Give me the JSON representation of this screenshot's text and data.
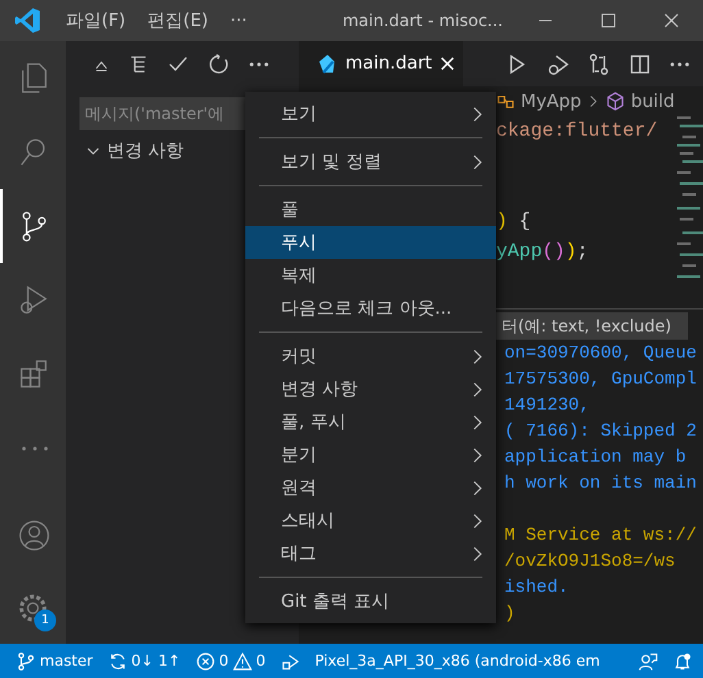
{
  "title_bar": {
    "menus": [
      "파일(F)",
      "편집(E)",
      "···"
    ],
    "title": "main.dart - misoc..."
  },
  "activity_bar": {
    "items": [
      {
        "kind": "files",
        "selected": false
      },
      {
        "kind": "search",
        "selected": false
      },
      {
        "kind": "scm",
        "selected": true
      },
      {
        "kind": "debug",
        "selected": false
      },
      {
        "kind": "extensions",
        "selected": false
      },
      {
        "kind": "more",
        "selected": false
      }
    ],
    "settings_badge": "1"
  },
  "sidebar": {
    "message": {
      "placeholder": "메시지('master'에"
    },
    "section": {
      "label": "변경 사항",
      "expanded": true
    }
  },
  "tab": {
    "label": "main.dart",
    "selected": true
  },
  "breadcrumb": [
    "MyApp",
    "build"
  ],
  "code_lines": [
    {
      "kind": "code",
      "tokens": [
        {
          "text": "ckage:flutter/",
          "kind": "string"
        }
      ]
    },
    {
      "kind": "blank"
    },
    {
      "kind": "blank"
    },
    {
      "kind": "code",
      "tokens": [
        {
          "text": ")",
          "kind": "bracket"
        },
        {
          "text": " {",
          "kind": "plain"
        }
      ]
    },
    {
      "kind": "code",
      "tokens": [
        {
          "text": "yApp",
          "kind": "class"
        },
        {
          "text": "()",
          "kind": "bracket2"
        },
        {
          "text": ")",
          "kind": "bracket"
        },
        {
          "text": ";",
          "kind": "plain"
        }
      ]
    }
  ],
  "panel": {
    "filter": {
      "placeholder": "터(예: text, !exclude)"
    },
    "lines": [
      {
        "text": "on=30970600, Queue",
        "kind": "info"
      },
      {
        "text": "17575300, GpuCompl",
        "kind": "info"
      },
      {
        "text": "1491230,",
        "kind": "info"
      },
      {
        "text": "( 7166): Skipped 2",
        "kind": "info"
      },
      {
        "text": "application may b",
        "kind": "info"
      },
      {
        "text": "h work on its main",
        "kind": "info"
      },
      {
        "kind": "blank"
      },
      {
        "text": "M Service at ws://",
        "kind": "warn"
      },
      {
        "text": "/ovZkO9J1So8=/ws",
        "kind": "warn"
      },
      {
        "text": "ished.",
        "kind": "info"
      },
      {
        "text": ")",
        "kind": "warn"
      }
    ]
  },
  "context_menu": [
    {
      "kind": "item",
      "label": "보기",
      "submenu": true,
      "selected": false
    },
    {
      "kind": "separator"
    },
    {
      "kind": "item",
      "label": "보기 및 정렬",
      "submenu": true,
      "selected": false
    },
    {
      "kind": "separator"
    },
    {
      "kind": "item",
      "label": "풀",
      "submenu": false,
      "selected": false
    },
    {
      "kind": "item",
      "label": "푸시",
      "submenu": false,
      "selected": true
    },
    {
      "kind": "item",
      "label": "복제",
      "submenu": false,
      "selected": false
    },
    {
      "kind": "item",
      "label": "다음으로 체크 아웃...",
      "submenu": false,
      "selected": false
    },
    {
      "kind": "separator"
    },
    {
      "kind": "item",
      "label": "커밋",
      "submenu": true,
      "selected": false
    },
    {
      "kind": "item",
      "label": "변경 사항",
      "submenu": true,
      "selected": false
    },
    {
      "kind": "item",
      "label": "풀, 푸시",
      "submenu": true,
      "selected": false
    },
    {
      "kind": "item",
      "label": "분기",
      "submenu": true,
      "selected": false
    },
    {
      "kind": "item",
      "label": "원격",
      "submenu": true,
      "selected": false
    },
    {
      "kind": "item",
      "label": "스태시",
      "submenu": true,
      "selected": false
    },
    {
      "kind": "item",
      "label": "태그",
      "submenu": true,
      "selected": false
    },
    {
      "kind": "separator"
    },
    {
      "kind": "item",
      "label": "Git 출력 표시",
      "submenu": false,
      "selected": false
    }
  ],
  "status_bar": {
    "branch": "master",
    "sync": "0↓ 1↑",
    "errors": "0",
    "warnings": "0",
    "device": "Pixel_3a_API_30_x86 (android-x86 em"
  }
}
